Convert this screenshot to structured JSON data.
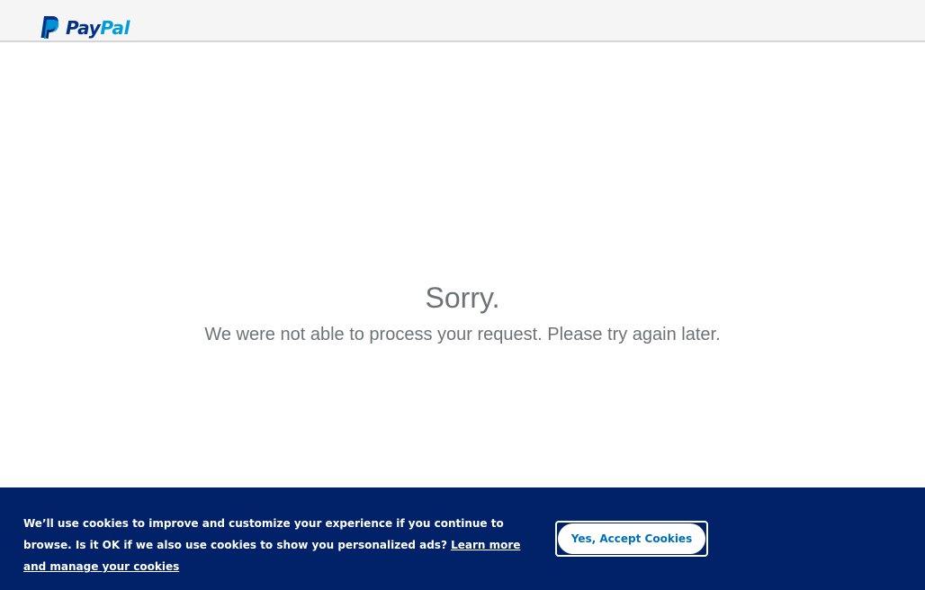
{
  "header": {
    "logo": {
      "part1": "Pay",
      "part2": "Pal",
      "colors": {
        "pay": "#003087",
        "pal": "#009cde"
      }
    }
  },
  "error": {
    "title": "Sorry.",
    "message": "We were not able to process your request. Please try again later."
  },
  "cookie_banner": {
    "text": "We’ll use cookies to improve and customize your experience if you continue to browse. Is it OK if we also use cookies to show you personalized ads?",
    "link_label": "Learn more and manage your cookies",
    "accept_label": "Yes, Accept Cookies",
    "background": "#012169"
  }
}
